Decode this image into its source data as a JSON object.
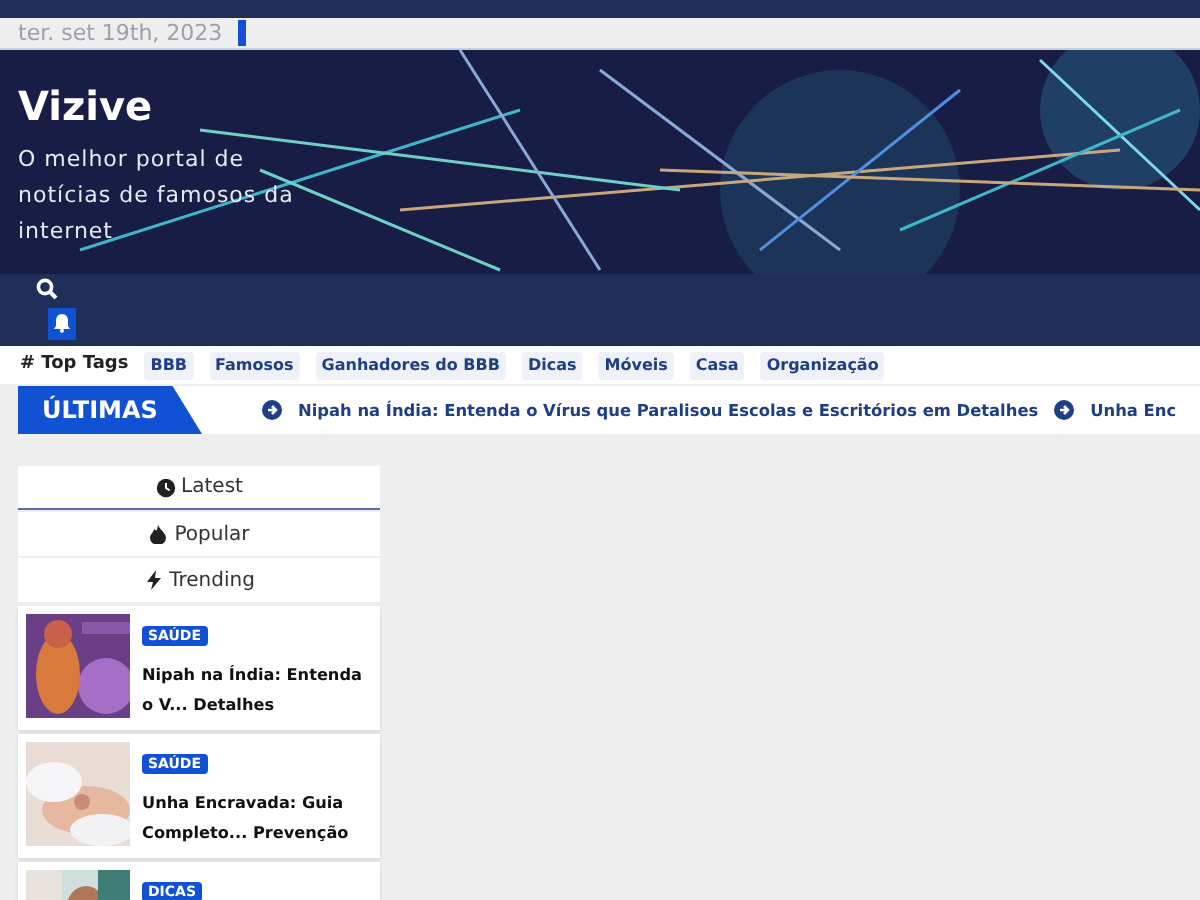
{
  "top_bar": {
    "date": "ter. set 19th, 2023"
  },
  "header": {
    "site_title": "Vizive",
    "tagline": "O melhor portal de notícias de famosos da internet"
  },
  "top_tags": {
    "label": "# Top Tags",
    "tags": [
      "BBB",
      "Famosos",
      "Ganhadores do BBB",
      "Dicas",
      "Móveis",
      "Casa",
      "Organização"
    ]
  },
  "ticker": {
    "label": "ÚLTIMAS",
    "items": [
      "Nipah na Índia: Entenda o Vírus que Paralisou Escolas e Escritórios em Detalhes",
      "Unha Enc"
    ]
  },
  "widget": {
    "tabs": [
      {
        "label": "Latest",
        "selected": true
      },
      {
        "label": "Popular",
        "selected": false
      },
      {
        "label": "Trending",
        "selected": false
      }
    ],
    "posts": [
      {
        "category": "SAÚDE",
        "title": "Nipah na Índia: Entenda o V... Detalhes"
      },
      {
        "category": "SAÚDE",
        "title": "Unha Encravada: Guia Completo... Prevenção"
      },
      {
        "category": "DICAS"
      }
    ]
  }
}
